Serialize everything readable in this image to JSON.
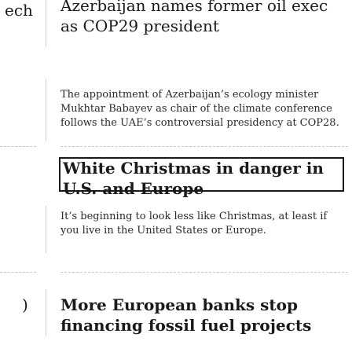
{
  "left_column": {
    "fragment_top": "ech"
  },
  "stories": [
    {
      "headline": "Azerbaijan names former oil exec as COP29 president",
      "summary": "The appointment of Azerbaijan’s ecology minister Mukhtar Babayev as chair of the climate conference follows the UAE’s controversial presidency at COP28."
    },
    {
      "headline": "White Christmas in danger in U.S. and Europe",
      "summary": "It’s beginning to look less like Christmas, at least if you live in the United States or Europe."
    },
    {
      "headline": "More European banks stop financing fossil fuel projects",
      "summary": ""
    }
  ]
}
